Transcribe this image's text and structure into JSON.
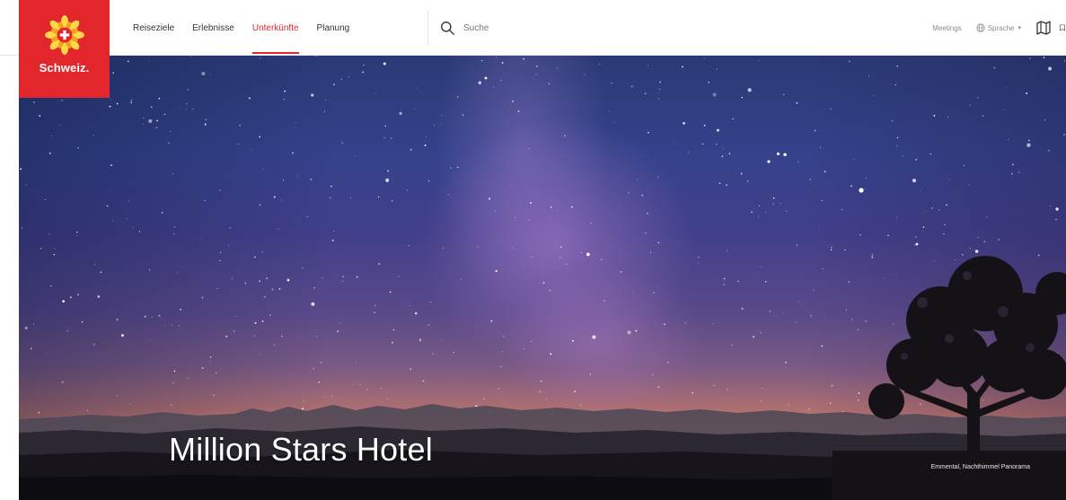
{
  "brand": {
    "logo_text": "Schweiz.",
    "color": "#e3262c"
  },
  "nav": {
    "items": [
      {
        "label": "Reiseziele",
        "active": false
      },
      {
        "label": "Erlebnisse",
        "active": false
      },
      {
        "label": "Unterkünfte",
        "active": true
      },
      {
        "label": "Planung",
        "active": false
      }
    ],
    "active_color": "#e3262c"
  },
  "search": {
    "icon": "search-icon",
    "placeholder": "Suche"
  },
  "utility": {
    "meetings_label": "Meetings",
    "language_label": "Sprache",
    "language_icon": "globe-icon",
    "map_icon": "map-icon",
    "extra_icon": "bookmark-icon"
  },
  "hero": {
    "title": "Million Stars Hotel",
    "caption": "Emmental, Nachthimmel Panorama"
  }
}
